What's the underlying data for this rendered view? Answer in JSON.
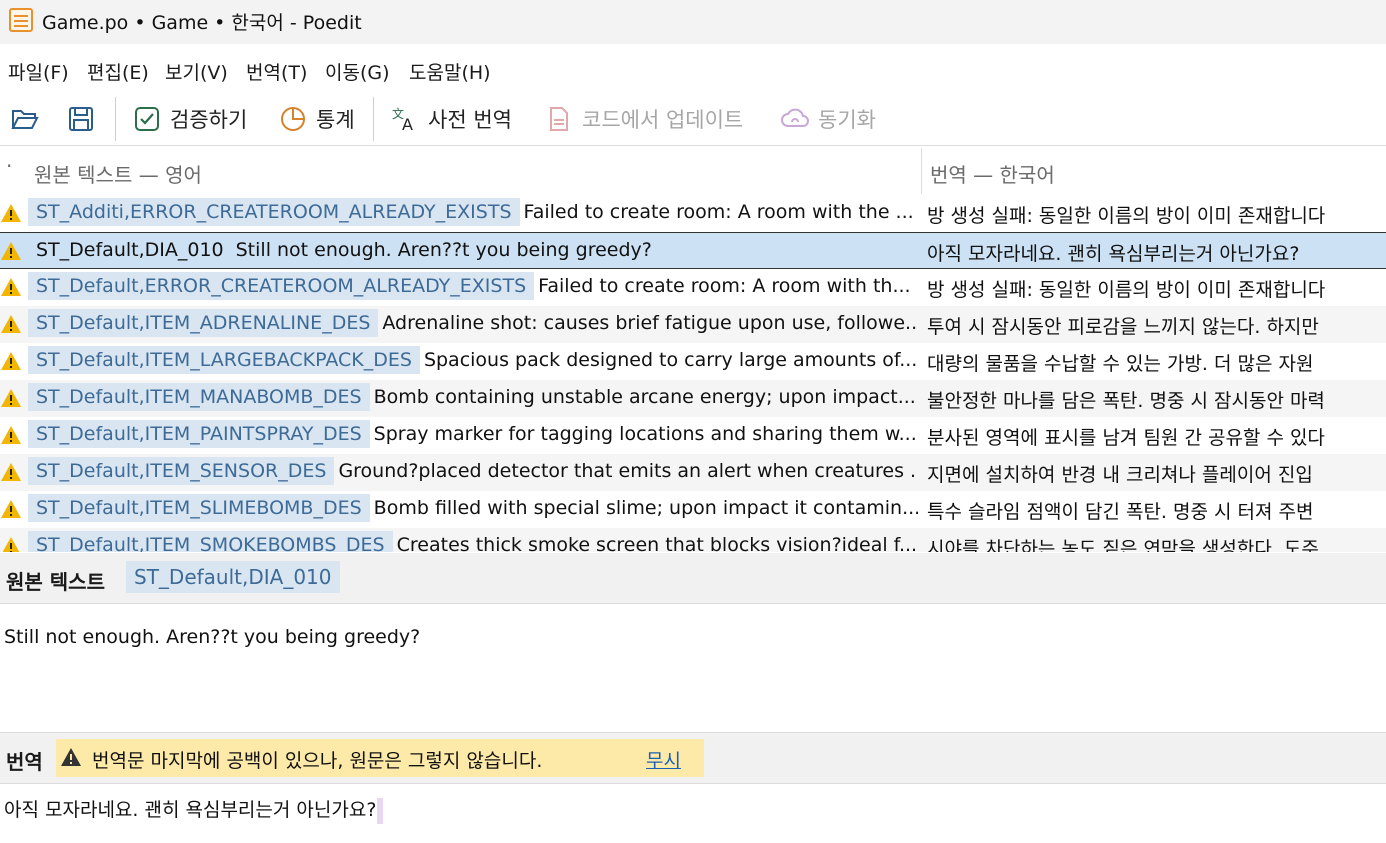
{
  "window": {
    "title": "Game.po • Game • 한국어 - Poedit"
  },
  "menu": [
    "파일(F)",
    "편집(E)",
    "보기(V)",
    "번역(T)",
    "이동(G)",
    "도움말(H)"
  ],
  "toolbar": {
    "validate": "검증하기",
    "stats": "통계",
    "pretranslate": "사전 번역",
    "update_from_code": "코드에서 업데이트",
    "sync": "동기화"
  },
  "list": {
    "indicator": "·",
    "source_header": "원본 텍스트 — 영어",
    "translation_header": "번역 — 한국어",
    "rows": [
      {
        "context": "ST_Additi,ERROR_CREATEROOM_ALREADY_EXISTS",
        "source": "Failed to create room: A room with the ...",
        "translation": "방 생성 실패: 동일한 이름의 방이 이미 존재합니다"
      },
      {
        "context": "ST_Default,DIA_010",
        "source": "Still not enough. Aren??t you being greedy?",
        "translation": "아직 모자라네요. 괜히 욕심부리는거 아닌가요?"
      },
      {
        "context": "ST_Default,ERROR_CREATEROOM_ALREADY_EXISTS",
        "source": "Failed to create room: A room with th...",
        "translation": "방 생성 실패: 동일한 이름의 방이 이미 존재합니다"
      },
      {
        "context": "ST_Default,ITEM_ADRENALINE_DES",
        "source": "Adrenaline shot: causes brief fatigue upon use, followe...",
        "translation": "투여 시 잠시동안 피로감을 느끼지 않는다. 하지만"
      },
      {
        "context": "ST_Default,ITEM_LARGEBACKPACK_DES",
        "source": "Spacious pack designed to carry large amounts of...",
        "translation": "대량의 물품을 수납할 수 있는 가방. 더 많은 자원"
      },
      {
        "context": "ST_Default,ITEM_MANABOMB_DES",
        "source": "Bomb containing unstable arcane energy; upon impact...",
        "translation": "불안정한 마나를 담은 폭탄. 명중 시 잠시동안 마력"
      },
      {
        "context": "ST_Default,ITEM_PAINTSPRAY_DES",
        "source": "Spray marker for tagging locations and sharing them w...",
        "translation": "분사된 영역에 표시를 남겨 팀원 간 공유할 수 있다"
      },
      {
        "context": "ST_Default,ITEM_SENSOR_DES",
        "source": "Ground?placed detector that emits an alert when creatures ...",
        "translation": "지면에 설치하여 반경 내 크리쳐나 플레이어 진입"
      },
      {
        "context": "ST_Default,ITEM_SLIMEBOMB_DES",
        "source": "Bomb filled with special slime; upon impact it contamin...",
        "translation": "특수 슬라임 점액이 담긴 폭탄. 명중 시 터져 주변"
      },
      {
        "context": "ST_Default,ITEM_SMOKEBOMBS_DES",
        "source": "Creates thick smoke screen that blocks vision?ideal f...",
        "translation": "시야를 차단하는 농도 짙은 연막을 생성한다. 도주"
      }
    ]
  },
  "source_panel": {
    "label": "원본 텍스트",
    "context": "ST_Default,DIA_010",
    "text": "Still not enough. Aren??t you being greedy?"
  },
  "translation_panel": {
    "label": "번역",
    "warning": "번역문 마지막에 공백이 있으나, 원문은 그렇지 않습니다.",
    "ignore": "무시",
    "text": "아직 모자라네요. 괜히 욕심부리는거 아닌가요?"
  },
  "colors": {
    "selected_row": "#cce1f4",
    "context_bg": "#d9e6f2",
    "context_text": "#3d6a96",
    "warning_bg": "#fde9a8",
    "warning_icon": "#f2b500",
    "link": "#1a5fb4"
  },
  "icons": {
    "app": "poedit-icon",
    "open": "folder-open-icon",
    "save": "save-icon",
    "validate": "check-icon",
    "stats": "pie-chart-icon",
    "pretranslate": "translate-icon",
    "update": "document-icon",
    "sync": "cloud-sync-icon",
    "warning": "warning-icon"
  }
}
